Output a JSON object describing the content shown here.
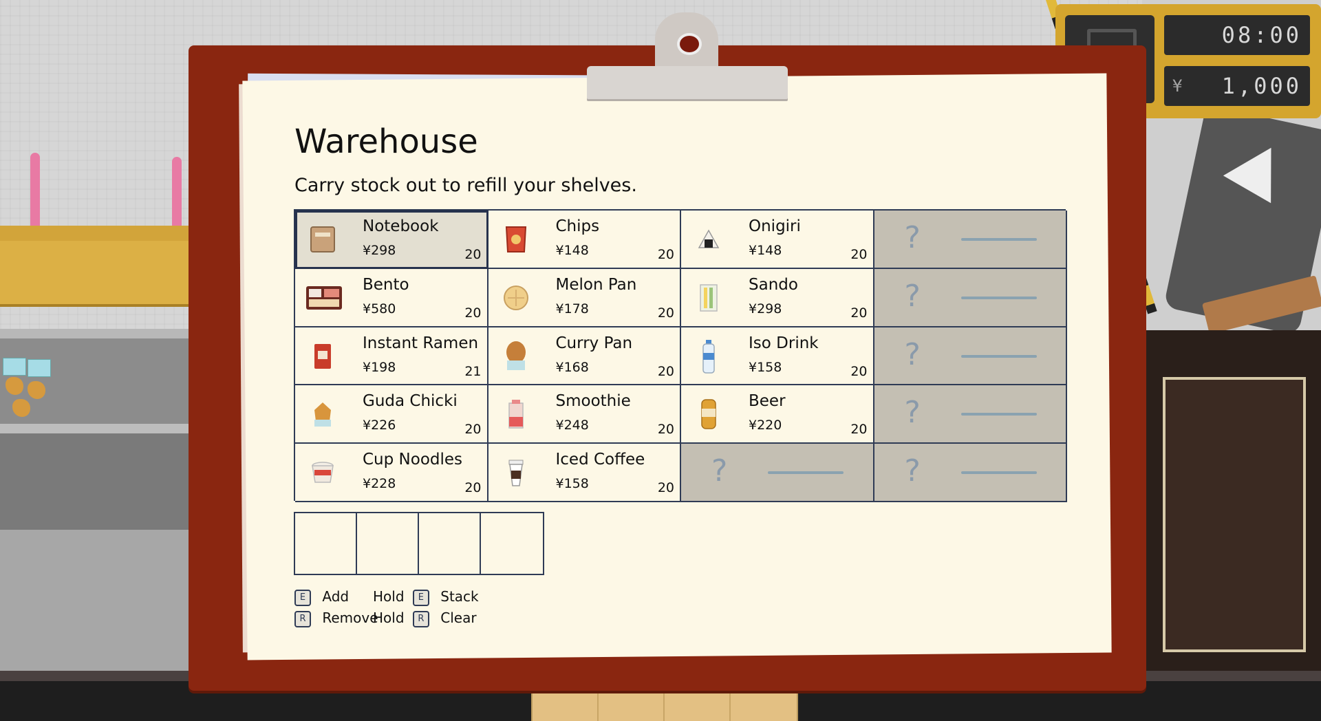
{
  "hud": {
    "time": "08:00",
    "currency": "¥",
    "money": "1,000"
  },
  "warehouse": {
    "title": "Warehouse",
    "subtitle": "Carry stock out to refill your shelves.",
    "items": [
      {
        "name": "Notebook",
        "price": "¥298",
        "qty": "20",
        "icon": "notebook-icon"
      },
      {
        "name": "Chips",
        "price": "¥148",
        "qty": "20",
        "icon": "chips-icon"
      },
      {
        "name": "Onigiri",
        "price": "¥148",
        "qty": "20",
        "icon": "onigiri-icon"
      },
      {
        "name": "Bento",
        "price": "¥580",
        "qty": "20",
        "icon": "bento-icon"
      },
      {
        "name": "Melon Pan",
        "price": "¥178",
        "qty": "20",
        "icon": "melon-pan-icon"
      },
      {
        "name": "Sando",
        "price": "¥298",
        "qty": "20",
        "icon": "sando-icon"
      },
      {
        "name": "Instant Ramen",
        "price": "¥198",
        "qty": "21",
        "icon": "instant-ramen-icon"
      },
      {
        "name": "Curry Pan",
        "price": "¥168",
        "qty": "20",
        "icon": "curry-pan-icon"
      },
      {
        "name": "Iso Drink",
        "price": "¥158",
        "qty": "20",
        "icon": "iso-drink-icon"
      },
      {
        "name": "Guda Chicki",
        "price": "¥226",
        "qty": "20",
        "icon": "chicken-icon"
      },
      {
        "name": "Smoothie",
        "price": "¥248",
        "qty": "20",
        "icon": "smoothie-icon"
      },
      {
        "name": "Beer",
        "price": "¥220",
        "qty": "20",
        "icon": "beer-icon"
      },
      {
        "name": "Cup Noodles",
        "price": "¥228",
        "qty": "20",
        "icon": "cup-noodles-icon"
      },
      {
        "name": "Iced Coffee",
        "price": "¥158",
        "qty": "20",
        "icon": "iced-coffee-icon"
      }
    ],
    "locked_label": "?"
  },
  "controls": {
    "add_key": "E",
    "add_label": "Add",
    "hold_label": "Hold",
    "stack_key": "E",
    "stack_label": "Stack",
    "remove_key": "R",
    "remove_label": "Remove",
    "hold2_label": "Hold",
    "clear_key": "R",
    "clear_label": "Clear"
  },
  "colors": {
    "board": "#8a2610",
    "paper": "#fdf8e6",
    "grid_line": "#2f3b55",
    "locked_cell": "#c4bfb3",
    "hud_frame": "#d4a52e"
  }
}
